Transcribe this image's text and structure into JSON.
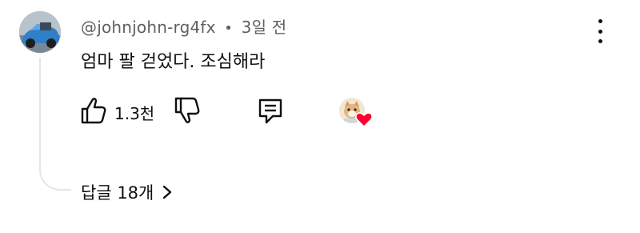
{
  "comment": {
    "author": "@johnjohn-rg4fx",
    "separator": "•",
    "time": "3일 전",
    "text": "엄마 팔 걷었다. 조심해라",
    "like_count": "1.3천",
    "replies_label": "답글 18개"
  },
  "icons": {
    "more": "more-vertical-icon",
    "like": "thumbs-up-icon",
    "dislike": "thumbs-down-icon",
    "reply": "comment-icon",
    "heart": "heart-icon",
    "replies_chevron": "chevron-right-icon"
  },
  "colors": {
    "text": "#0f0f0f",
    "meta": "#606060",
    "thread_line": "#e5e5e5",
    "heart": "#ff0033"
  }
}
